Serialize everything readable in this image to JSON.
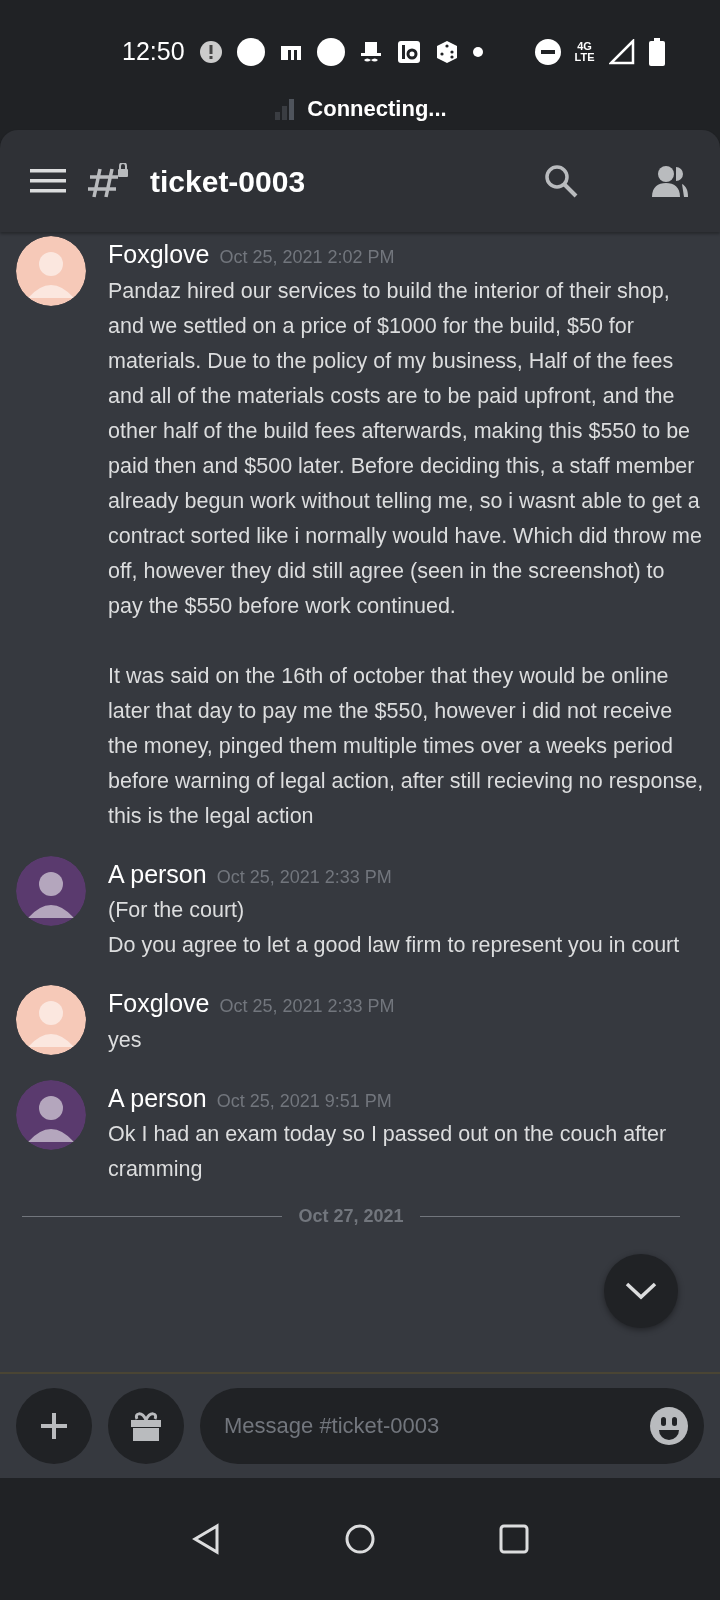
{
  "status_bar": {
    "time": "12:50",
    "network_top": "4G",
    "network_bottom": "LTE"
  },
  "connection_banner": "Connecting...",
  "channel": {
    "name": "ticket-0003"
  },
  "messages": [
    {
      "author": "Foxglove",
      "color": "#f6c9b8",
      "timestamp": "Oct 25, 2021 2:02 PM",
      "paragraphs": [
        "Pandaz hired our services to build the interior of their shop, and we settled on a price of $1000 for the build, $50 for materials. Due to the policy of my business, Half of the fees and all of the materials costs are to be paid upfront, and the other half of the build fees afterwards, making this $550 to be paid then and $500 later. Before deciding this, a staff member already begun work without telling me, so i wasnt able to get a contract sorted like i normally would have. Which did throw me off, however they did still agree (seen in the screenshot) to pay the $550 before work continued.",
        "It was said on the 16th of october that they would be online later that day to pay me the $550, however i did not receive the money, pinged them multiple times over a weeks period before warning of legal action, after still recieving no response, this is the legal action"
      ]
    },
    {
      "author": "A person",
      "color": "#5a3a6e",
      "timestamp": "Oct 25, 2021 2:33 PM",
      "paragraphs": [
        "(For the court)\nDo you agree to let a good law firm to represent you in court"
      ]
    },
    {
      "author": "Foxglove",
      "color": "#f6c9b8",
      "timestamp": "Oct 25, 2021 2:33 PM",
      "paragraphs": [
        "yes"
      ]
    },
    {
      "author": "A person",
      "color": "#5a3a6e",
      "timestamp": "Oct 25, 2021 9:51 PM",
      "paragraphs": [
        "Ok I had an exam today so I passed out on the couch after cramming"
      ]
    }
  ],
  "date_divider": "Oct 27, 2021",
  "composer": {
    "placeholder": "Message #ticket-0003"
  }
}
